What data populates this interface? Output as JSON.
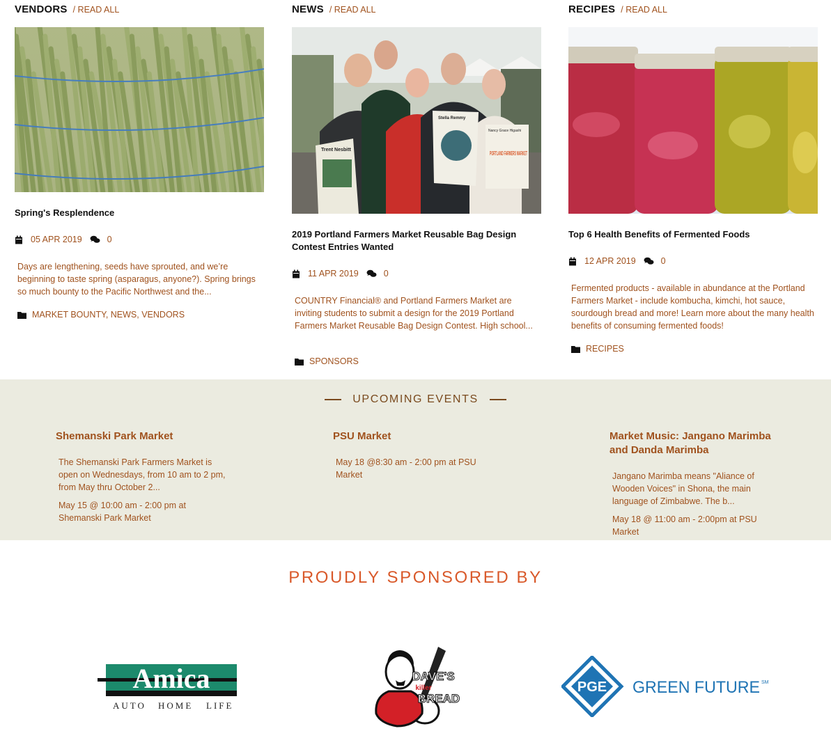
{
  "columns": [
    {
      "heading": "VENDORS",
      "read_all": "/ READ ALL",
      "post": {
        "title": "Spring's Resplendence",
        "date": "05 APR 2019",
        "comments": "0",
        "excerpt": "Days are lengthening, seeds have sprouted, and we’re beginning to taste spring (asparagus, anyone?). Spring brings so much bounty to the Pacific Northwest and the...",
        "categories": [
          "MARKET BOUNTY",
          "NEWS",
          "VENDORS"
        ]
      }
    },
    {
      "heading": "NEWS",
      "read_all": "/ READ ALL",
      "post": {
        "title": "2019 Portland Farmers Market Reusable Bag Design Contest Entries Wanted",
        "date": "11 APR 2019",
        "comments": "0",
        "excerpt": "COUNTRY Financial® and Portland Farmers Market are inviting students to submit a design for the 2019 Portland Farmers Market Reusable Bag Design Contest. High school...",
        "categories": [
          "SPONSORS"
        ],
        "photo_text": {
          "sign1": "Trent Nesbitt",
          "sign2": "Stella Remmy",
          "sign3": "Nancy Grace Higashi",
          "sign3_sub": "PORTLAND FARMERS MARKET"
        }
      }
    },
    {
      "heading": "RECIPES",
      "read_all": "/ READ ALL",
      "post": {
        "title": "Top 6 Health Benefits of Fermented Foods",
        "date": "12 APR 2019",
        "comments": "0",
        "excerpt": "Fermented products - available in abundance at the Portland Farmers Market - include kombucha, kimchi, hot sauce, sourdough bread and more! Learn more about the many health benefits of consuming fermented foods!",
        "categories": [
          "RECIPES"
        ]
      }
    }
  ],
  "events": {
    "heading": "UPCOMING EVENTS",
    "items": [
      {
        "title": "Shemanski Park Market",
        "description": "The Shemanski Park Farmers Market is open on Wednesdays, from 10 am to 2 pm, from May thru October 2...",
        "when": "May 15 @ 10:00 am - 2:00 pm at Shemanski Park Market"
      },
      {
        "title": "PSU Market",
        "description": "",
        "when": "May 18 @8:30 am - 2:00 pm at PSU Market"
      },
      {
        "title": "Market Music: Jangano Marimba and Danda Marimba",
        "description": "Jangano Marimba means \"Aliance of Wooden Voices\" in Shona, the main language of Zimbabwe. The b...",
        "when": "May 18 @ 11:00 am - 2:00pm at PSU Market"
      }
    ]
  },
  "sponsors": {
    "heading": "PROUDLY SPONSORED BY",
    "amica": {
      "name": "Amica",
      "tagline_auto": "Auto",
      "tagline_home": "Home",
      "tagline_life": "Life"
    },
    "daves": {
      "line1": "DAVE'S",
      "killer": "killer",
      "line2": "BREAD"
    },
    "pge": {
      "mark": "PGE",
      "text": "GREEN FUTURE",
      "sm": "SM"
    }
  },
  "colors": {
    "accent": "#a0521e",
    "heading_orange": "#d9592a",
    "events_bg": "#ebebe0",
    "amica_green": "#1c8a6c",
    "pge_blue": "#1f74b4"
  },
  "icons": [
    "calendar-icon",
    "comments-icon",
    "folder-icon"
  ]
}
